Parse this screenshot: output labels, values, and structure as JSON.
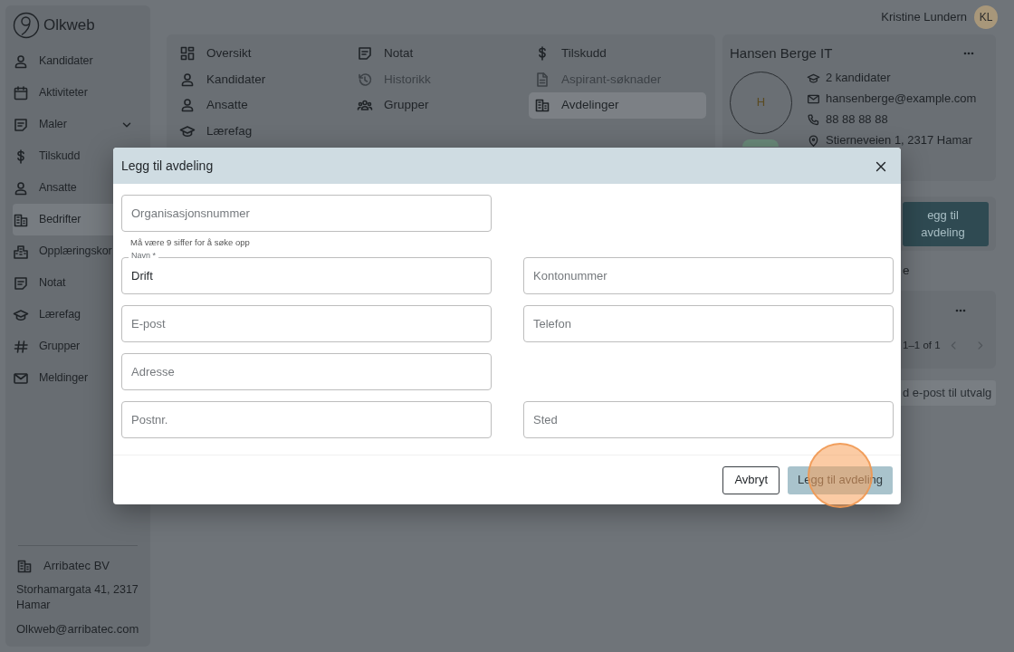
{
  "brand": {
    "name": "Olkweb"
  },
  "sidebar": {
    "items": [
      {
        "label": "Kandidater",
        "kind": "link",
        "selected": false
      },
      {
        "label": "Aktiviteter",
        "kind": "link",
        "selected": false
      },
      {
        "label": "Maler",
        "kind": "group",
        "selected": false
      },
      {
        "label": "Tilskudd",
        "kind": "link",
        "selected": false
      },
      {
        "label": "Ansatte",
        "kind": "link",
        "selected": false
      },
      {
        "label": "Bedrifter",
        "kind": "link",
        "selected": true
      },
      {
        "label": "Opplæringskor",
        "kind": "link",
        "selected": false
      },
      {
        "label": "Notat",
        "kind": "link",
        "selected": false
      },
      {
        "label": "Lærefag",
        "kind": "link",
        "selected": false
      },
      {
        "label": "Grupper",
        "kind": "link",
        "selected": false
      },
      {
        "label": "Meldinger",
        "kind": "link",
        "selected": false
      }
    ],
    "footer": {
      "company": "Arribatec BV",
      "address": "Storhamargata 41, 2317 Hamar",
      "email": "Olkweb@arribatec.com"
    }
  },
  "user": {
    "name": "Kristine Lundern",
    "initials": "KL"
  },
  "company_nav": {
    "items": [
      {
        "label": "Oversikt",
        "selected": false,
        "disabled": false
      },
      {
        "label": "Notat",
        "selected": false,
        "disabled": false
      },
      {
        "label": "Tilskudd",
        "selected": false,
        "disabled": false
      },
      {
        "label": "Kandidater",
        "selected": false,
        "disabled": false
      },
      {
        "label": "Historikk",
        "selected": false,
        "disabled": true
      },
      {
        "label": "Aspirant-søknader",
        "selected": false,
        "disabled": true
      },
      {
        "label": "Ansatte",
        "selected": false,
        "disabled": false
      },
      {
        "label": "Grupper",
        "selected": false,
        "disabled": false
      },
      {
        "label": "Avdelinger",
        "selected": true,
        "disabled": false
      },
      {
        "label": "Lærefag",
        "selected": false,
        "disabled": false
      }
    ]
  },
  "company_card": {
    "title": "Hansen Berge IT",
    "initial": "H",
    "candidates": "2 kandidater",
    "email": "hansenberge@example.com",
    "phone": "88 88 88 88",
    "address": "Stierneveien 1, 2317 Hamar"
  },
  "departments_card": {
    "button": "egg til avdeling"
  },
  "section_text": "e",
  "list_card": {
    "pagination": "1–1 of 1"
  },
  "email_button": "d e-post til utvalg",
  "dialog": {
    "title": "Legg til avdeling",
    "rows": [
      [
        {
          "placeholder": "Organisasjonsnummer",
          "helper": "Må være 9 siffer for å søke opp"
        }
      ],
      [
        {
          "label": "Navn *",
          "value": "Drift"
        },
        {
          "placeholder": "Kontonummer"
        }
      ],
      [
        {
          "placeholder": "E-post"
        },
        {
          "placeholder": "Telefon"
        }
      ],
      [
        {
          "placeholder": "Adresse"
        }
      ],
      [
        {
          "placeholder": "Postnr."
        },
        {
          "placeholder": "Sted"
        }
      ]
    ],
    "buttons": [
      {
        "label": "Avbryt",
        "kind": "outline"
      },
      {
        "label": "Legg til avdeling",
        "kind": "primary"
      }
    ]
  }
}
